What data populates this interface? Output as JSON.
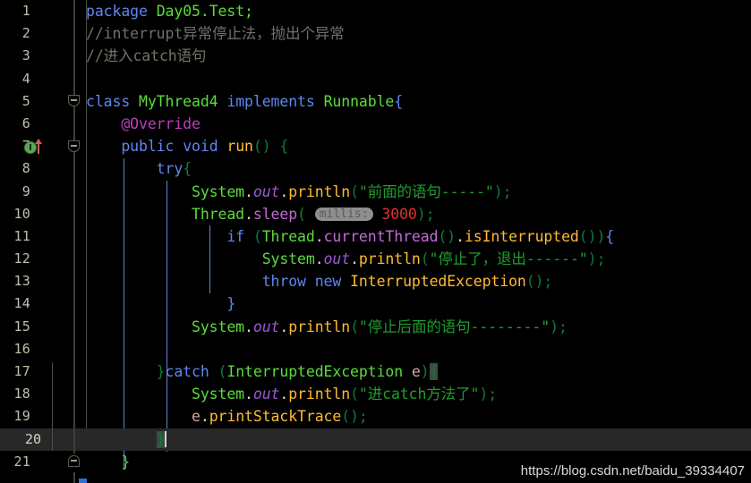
{
  "editor": {
    "theme_background": "#000000",
    "current_line_number": 20,
    "current_line_background": "#282828",
    "watermark": "https://blog.csdn.net/baidu_39334407"
  },
  "gutter": {
    "line_numbers": [
      1,
      2,
      3,
      4,
      5,
      6,
      7,
      8,
      9,
      10,
      11,
      12,
      13,
      14,
      15,
      16,
      17,
      18,
      19,
      20,
      21
    ],
    "markers": [
      {
        "line": 7,
        "icon": "override-method-icon",
        "tooltip_label": "Implements method"
      }
    ],
    "fold_markers": [
      {
        "line": 5,
        "icon": "fold-collapse-icon",
        "state": "expanded"
      },
      {
        "line": 7,
        "icon": "fold-collapse-icon",
        "state": "expanded"
      },
      {
        "line": 21,
        "icon": "fold-collapse-icon",
        "state": "expanded"
      }
    ]
  },
  "code": {
    "language": "java",
    "lines": [
      {
        "n": 1,
        "text": "package Day05.Test;"
      },
      {
        "n": 2,
        "text": "//interrupt异常停止法，抛出个异常"
      },
      {
        "n": 3,
        "text": "//进入catch语句"
      },
      {
        "n": 4,
        "text": ""
      },
      {
        "n": 5,
        "text": "class MyThread4 implements Runnable{"
      },
      {
        "n": 6,
        "text": "    @Override"
      },
      {
        "n": 7,
        "text": "    public void run() {"
      },
      {
        "n": 8,
        "text": "        try{"
      },
      {
        "n": 9,
        "text": "            System.out.println(\"前面的语句-----\");"
      },
      {
        "n": 10,
        "text": "            Thread.sleep( millis: 3000);"
      },
      {
        "n": 11,
        "text": "                if (Thread.currentThread().isInterrupted()){"
      },
      {
        "n": 12,
        "text": "                    System.out.println(\"停止了，退出------\");"
      },
      {
        "n": 13,
        "text": "                    throw new InterruptedException();"
      },
      {
        "n": 14,
        "text": "                }"
      },
      {
        "n": 15,
        "text": "            System.out.println(\"停止后面的语句--------\");"
      },
      {
        "n": 16,
        "text": ""
      },
      {
        "n": 17,
        "text": "        }catch (InterruptedException e){"
      },
      {
        "n": 18,
        "text": "            System.out.println(\"进catch方法了\");"
      },
      {
        "n": 19,
        "text": "            e.printStackTrace();"
      },
      {
        "n": 20,
        "text": "        }"
      },
      {
        "n": 21,
        "text": "    }"
      }
    ],
    "tokens": {
      "l1_kw": "package",
      "l1_pkg": "Day05.Test",
      "l1_semi": ";",
      "l2_comment": "//interrupt异常停止法，抛出个异常",
      "l3_comment": "//进入catch语句",
      "l5_kw_class": "class",
      "l5_name": "MyThread4",
      "l5_kw_impl": "implements",
      "l5_iface": "Runnable",
      "l5_brace": "{",
      "l6_anno": "@Override",
      "l7_kw_public": "public",
      "l7_kw_void": "void",
      "l7_method": "run",
      "l7_parens": "()",
      "l7_brace": "{",
      "l8_kw_try": "try",
      "l8_brace": "{",
      "l9_system": "System",
      "l9_out": "out",
      "l9_println": "println",
      "l9_string": "\"前面的语句-----\"",
      "l10_thread": "Thread",
      "l10_sleep": "sleep",
      "l10_hint": "millis:",
      "l10_number": "3000",
      "l11_kw_if": "if",
      "l11_thread": "Thread",
      "l11_currentThread": "currentThread",
      "l11_isInterrupted": "isInterrupted",
      "l12_string": "\"停止了，退出------\"",
      "l13_kw_throw": "throw",
      "l13_kw_new": "new",
      "l13_type": "InterruptedException",
      "l14_close": "}",
      "l15_string": "\"停止后面的语句--------\"",
      "l17_close": "}",
      "l17_kw_catch": "catch",
      "l17_type": "InterruptedException",
      "l17_var": "e",
      "l17_brace": "{",
      "l18_string": "\"进catch方法了\"",
      "l19_var": "e",
      "l19_method": "printStackTrace",
      "l20_close": "}",
      "l21_close": "}"
    }
  },
  "colors": {
    "background": "#000000",
    "keyword": "#5f86f2",
    "identifier_green": "#5bdc3c",
    "annotation": "#bb3fbb",
    "method": "#ffbb33",
    "field_italic": "#9b59d6",
    "string": "#1f9e2e",
    "number": "#e03030",
    "comment": "#6e7468",
    "punctuation": "#0f7a3c",
    "line_number": "#c0bfae",
    "indent_guide": "#6080d0"
  }
}
